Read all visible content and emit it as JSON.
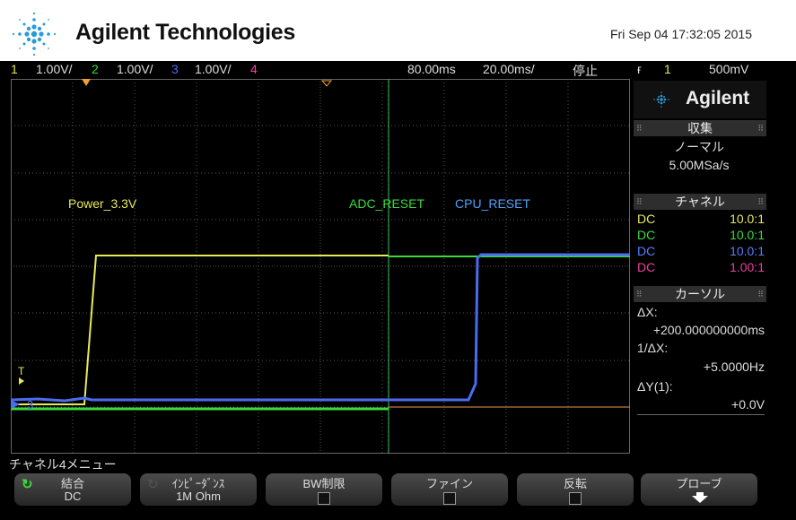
{
  "header": {
    "brand": "Agilent Technologies",
    "datetime": "Fri Sep 04 17:32:05 2015"
  },
  "status": {
    "ch1_num": "1",
    "ch1_scale": "1.00V/",
    "ch2_num": "2",
    "ch2_scale": "1.00V/",
    "ch3_num": "3",
    "ch3_scale": "1.00V/",
    "ch4_num": "4",
    "time_delay": "80.00ms",
    "time_scale": "20.00ms/",
    "run_state": "停止",
    "trig_slope": "ғ",
    "trig_source": "1",
    "trig_level": "500mV"
  },
  "colors": {
    "ch1": "#e8e85a",
    "ch2": "#3adb3a",
    "ch3": "#4a6cf0",
    "ch4": "#ee3ea0",
    "orange": "#f0a030"
  },
  "traces": {
    "labels": {
      "power": "Power_3.3V",
      "adc": "ADC_RESET",
      "cpu": "CPU_RESET"
    },
    "markers": {
      "trigger": "T",
      "ground": "3"
    }
  },
  "panel": {
    "brand": "Agilent",
    "acq_header": "収集",
    "acq_mode": "ノーマル",
    "acq_rate": "5.00MSa/s",
    "chan_header": "チャネル",
    "channels": [
      {
        "coupling": "DC",
        "probe": "10.0:1"
      },
      {
        "coupling": "DC",
        "probe": "10.0:1"
      },
      {
        "coupling": "DC",
        "probe": "10.0:1"
      },
      {
        "coupling": "DC",
        "probe": "1.00:1"
      }
    ],
    "cursor_header": "カーソル",
    "dx_label": "ΔX:",
    "dx_value": "+200.000000000ms",
    "inv_dx_label": "1/ΔX:",
    "inv_dx_value": "+5.0000Hz",
    "dy_label": "ΔY(1):",
    "dy_value": "+0.0V"
  },
  "menu": {
    "title": "チャネル4メニュー",
    "softkeys": [
      {
        "label": "結合",
        "value": "DC"
      },
      {
        "label": "ｲﾝﾋﾟｰﾀﾞﾝｽ",
        "value": "1M Ohm"
      },
      {
        "label": "BW制限",
        "value": ""
      },
      {
        "label": "ファイン",
        "value": ""
      },
      {
        "label": "反転",
        "value": ""
      },
      {
        "label": "プローブ",
        "value": ""
      }
    ]
  }
}
